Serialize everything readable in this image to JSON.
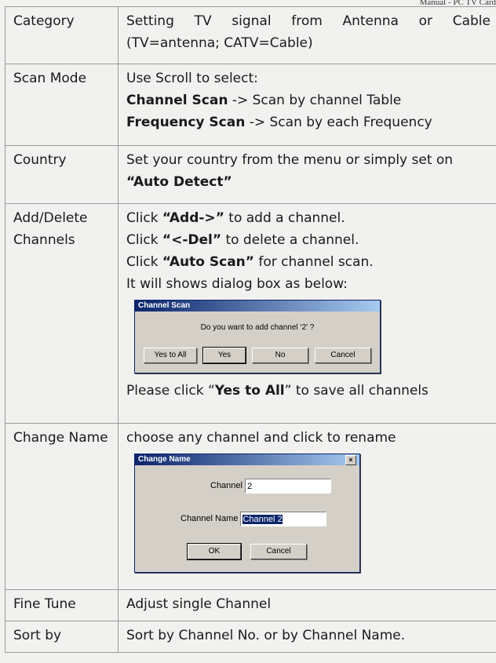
{
  "page_header": "Manual - PC TV Card",
  "rows": {
    "category": {
      "label": "Category",
      "line1": "Setting TV signal from Antenna or Cable",
      "line2": "(TV=antenna; CATV=Cable)"
    },
    "scan_mode": {
      "label": "Scan Mode",
      "line1": "Use Scroll to select:",
      "channel_scan_bold": "Channel Scan",
      "channel_scan_rest": " -> Scan by channel Table",
      "freq_scan_bold": "Frequency Scan",
      "freq_scan_rest": " -> Scan by each Frequency"
    },
    "country": {
      "label": "Country",
      "line1": "Set your country from the menu or simply set on",
      "line2_bold": "“Auto Detect”"
    },
    "add_delete": {
      "label": "Add/Delete Channels",
      "click": "Click ",
      "add_bold": "“Add->”",
      "add_rest": " to add a channel.",
      "del_bold": "“<-Del”",
      "del_rest": " to delete a channel.",
      "auto_bold": "“Auto Scan”",
      "auto_rest": " for channel scan.",
      "dialog_line": "It will shows dialog box as below:",
      "after_pre": "Please click “",
      "after_bold": "Yes to All",
      "after_post": "” to save all channels"
    },
    "change_name": {
      "label": "Change Name",
      "line1": "choose any channel and click to rename"
    },
    "fine_tune": {
      "label": "Fine Tune",
      "line1": "Adjust single Channel"
    },
    "sort_by": {
      "label": "Sort by",
      "line1": "Sort by Channel No. or by Channel Name."
    }
  },
  "channel_scan_dialog": {
    "title": "Channel Scan",
    "message": "Do you want to add channel ‘2’ ?",
    "buttons": {
      "yes_to_all": "Yes to All",
      "yes": "Yes",
      "no": "No",
      "cancel": "Cancel"
    }
  },
  "change_name_dialog": {
    "title": "Change Name",
    "close": "×",
    "channel_label": "Channel",
    "channel_value": "2",
    "name_label": "Channel Name",
    "name_value": "Channel 2",
    "buttons": {
      "ok": "OK",
      "cancel": "Cancel"
    }
  }
}
